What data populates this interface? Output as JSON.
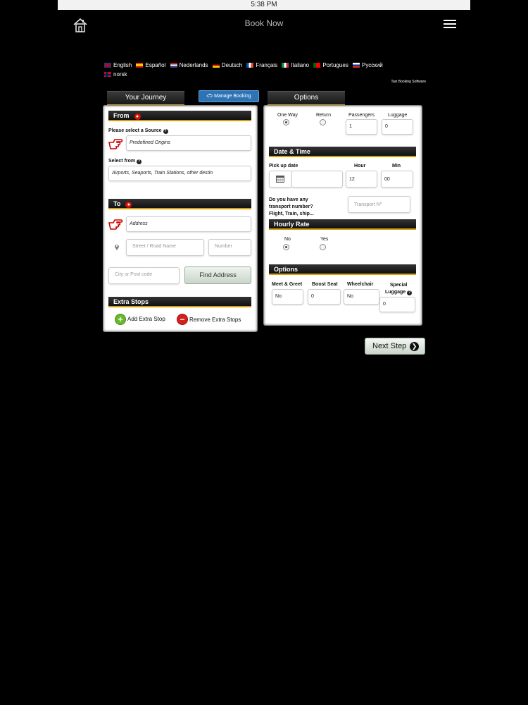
{
  "status_bar": {
    "time": "5:38 PM"
  },
  "top_bar": {
    "title": "Book Now",
    "home_icon": "home-icon",
    "menu_icon": "hamburger-menu-icon"
  },
  "languages": [
    {
      "label": "English",
      "flag": "uk"
    },
    {
      "label": "Español",
      "flag": "es"
    },
    {
      "label": "Nederlands",
      "flag": "nl"
    },
    {
      "label": "Deutsch",
      "flag": "de"
    },
    {
      "label": "Français",
      "flag": "fr"
    },
    {
      "label": "Italiano",
      "flag": "it"
    },
    {
      "label": "Portugues",
      "flag": "pt"
    },
    {
      "label": "Русский",
      "flag": "ru"
    },
    {
      "label": "norsk",
      "flag": "no"
    }
  ],
  "tagline": "Taxi Booking Software",
  "tabs": {
    "journey": "Your Journey",
    "manage": "Manage Booking",
    "options": "Options"
  },
  "journey": {
    "from": {
      "heading": "From",
      "source_label": "Please select a Source",
      "source_value": "Predefined Origins",
      "select_from_label": "Select from",
      "select_from_value": "Airports, Seaports, Train Stations, other destin"
    },
    "to": {
      "heading": "To",
      "address_value": "Address",
      "street_placeholder": "Street / Road Name",
      "number_placeholder": "Number",
      "city_placeholder": "City or Post code",
      "find_button": "Find Address"
    },
    "extra_stops": {
      "heading": "Extra Stops",
      "add_label": "Add Extra Stop",
      "remove_label": "Remove Extra Stops"
    }
  },
  "options_panel": {
    "trip": {
      "one_way": "One Way",
      "return": "Return",
      "passengers_label": "Passengers",
      "passengers_value": "1",
      "luggage_label": "Luggage",
      "luggage_value": "0"
    },
    "date_time": {
      "heading": "Date & Time",
      "pickup_label": "Pick up date",
      "pickup_value": "",
      "hour_label": "Hour",
      "hour_value": "12",
      "min_label": "Min",
      "min_value": "00",
      "transport_question_1": "Do you have any",
      "transport_question_2": "transport number?",
      "transport_question_3": "Flight, Train, ship...",
      "transport_placeholder": "Transport Nº"
    },
    "hourly": {
      "heading": "Hourly Rate",
      "no": "No",
      "yes": "Yes"
    },
    "extras": {
      "heading": "Options",
      "meet_label": "Meet & Greet",
      "meet_value": "No",
      "boost_label": "Boost Seat",
      "boost_value": "0",
      "wheelchair_label": "Wheelchair",
      "wheelchair_value": "No",
      "special_label_1": "Special",
      "special_label_2": "Luggage",
      "special_value": "0"
    }
  },
  "next_button": "Next Step"
}
